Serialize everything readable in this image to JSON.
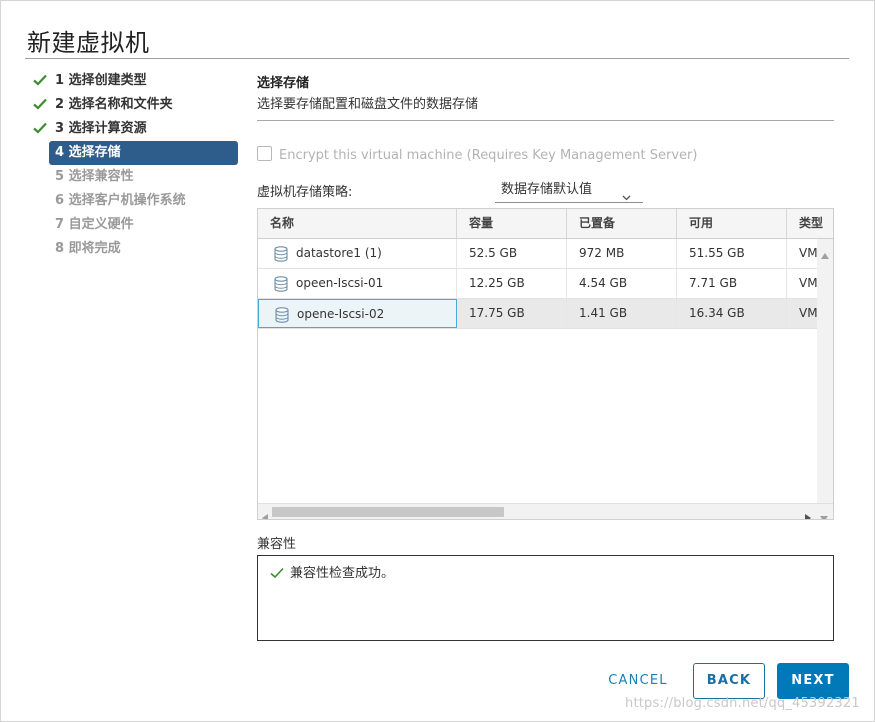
{
  "dialog": {
    "title": "新建虚拟机"
  },
  "steps": [
    {
      "label": "1 选择创建类型",
      "state": "done"
    },
    {
      "label": "2 选择名称和文件夹",
      "state": "done"
    },
    {
      "label": "3 选择计算资源",
      "state": "done"
    },
    {
      "label": "4 选择存储",
      "state": "active"
    },
    {
      "label": "5 选择兼容性",
      "state": "todo"
    },
    {
      "label": "6 选择客户机操作系统",
      "state": "todo"
    },
    {
      "label": "7 自定义硬件",
      "state": "todo"
    },
    {
      "label": "8 即将完成",
      "state": "todo"
    }
  ],
  "section": {
    "title": "选择存储",
    "subtitle": "选择要存储配置和磁盘文件的数据存储"
  },
  "encrypt": {
    "label": "Encrypt this virtual machine (Requires Key Management Server)",
    "checked": false
  },
  "policy": {
    "label": "虚拟机存储策略:",
    "selected": "数据存储默认值"
  },
  "grid": {
    "columns": [
      "名称",
      "容量",
      "已置备",
      "可用",
      "类型"
    ],
    "rows": [
      {
        "name": "datastore1 (1)",
        "capacity": "52.5 GB",
        "provisioned": "972 MB",
        "free": "51.55 GB",
        "type": "VM"
      },
      {
        "name": "opeen-Iscsi-01",
        "capacity": "12.25 GB",
        "provisioned": "4.54 GB",
        "free": "7.71 GB",
        "type": "VM"
      },
      {
        "name": "opene-Iscsi-02",
        "capacity": "17.75 GB",
        "provisioned": "1.41 GB",
        "free": "16.34 GB",
        "type": "VM"
      }
    ],
    "selected_row": 2
  },
  "compatibility": {
    "label": "兼容性",
    "message": "兼容性检查成功。"
  },
  "footer": {
    "cancel": "CANCEL",
    "back": "BACK",
    "next": "NEXT"
  },
  "watermark": "https://blog.csdn.net/qq_45392321",
  "colors": {
    "accent": "#0079b8",
    "active_step": "#2e5d8c",
    "success": "#3c8d2f"
  }
}
